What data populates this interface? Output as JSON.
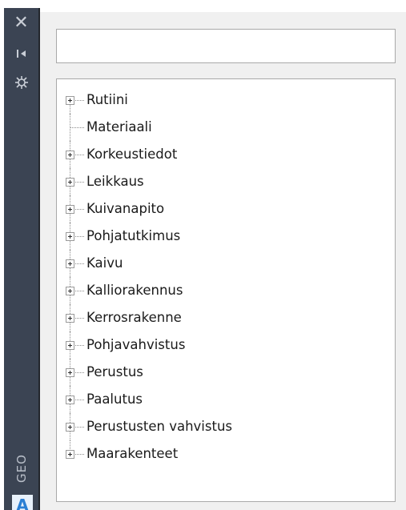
{
  "titlebar": {
    "title": "GEO",
    "close_glyph": "✕",
    "app_logo_letter": "A",
    "icons": [
      "close-icon",
      "auto-hide-icon",
      "properties-icon",
      "app-logo-icon"
    ]
  },
  "search": {
    "value": "",
    "placeholder": ""
  },
  "tree": {
    "items": [
      {
        "label": "Rutiini",
        "expandable": true
      },
      {
        "label": "Materiaali",
        "expandable": false
      },
      {
        "label": "Korkeustiedot",
        "expandable": true
      },
      {
        "label": "Leikkaus",
        "expandable": true
      },
      {
        "label": "Kuivanapito",
        "expandable": true
      },
      {
        "label": "Pohjatutkimus",
        "expandable": true
      },
      {
        "label": "Kaivu",
        "expandable": true
      },
      {
        "label": "Kalliorakennus",
        "expandable": true
      },
      {
        "label": "Kerrosrakenne",
        "expandable": true
      },
      {
        "label": "Pohjavahvistus",
        "expandable": true
      },
      {
        "label": "Perustus",
        "expandable": true
      },
      {
        "label": "Paalutus",
        "expandable": true
      },
      {
        "label": "Perustusten vahvistus",
        "expandable": true
      },
      {
        "label": "Maarakenteet",
        "expandable": true
      }
    ]
  },
  "colors": {
    "titlebar_bg": "#3b4453",
    "palette_bg": "#f0f0f0",
    "logo_blue": "#2a7fd4"
  }
}
